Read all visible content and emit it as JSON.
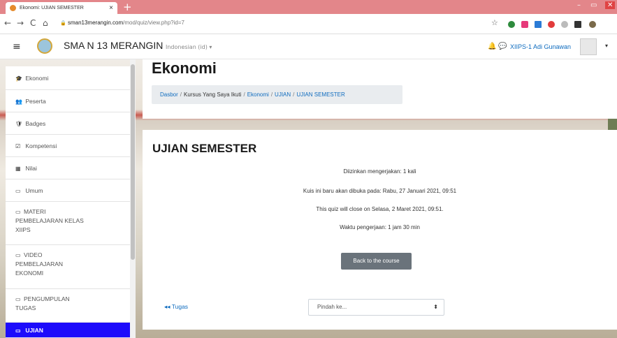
{
  "browser": {
    "tab_title": "Ekonomi: UJIAN SEMESTER",
    "tab_close": "×",
    "new_tab": "+",
    "url_host": "sman13merangin.com",
    "url_path": "/mod/quiz/view.php?id=7",
    "back_icon": "←",
    "forward_icon": "→",
    "reload_icon": "C",
    "home_icon": "⌂",
    "lock_icon": "🔒",
    "star_icon": "☆",
    "minimize": "–",
    "maximize": "▭",
    "close": "✕"
  },
  "navbar": {
    "menu_icon": "≡",
    "site_name": "SMA N 13 MERANGIN",
    "language": "Indonesian (id) ▾",
    "bell_icon": "🔔",
    "chat_icon": "💬",
    "user_name": "XIIPS-1 Adi Gunawan",
    "user_caret": "▾"
  },
  "drawer": {
    "items": [
      {
        "icon": "🎓",
        "label": "Ekonomi"
      },
      {
        "icon": "👥",
        "label": "Peserta"
      },
      {
        "icon": "🛡",
        "label": "Badges"
      },
      {
        "icon": "☑",
        "label": "Kompetensi"
      },
      {
        "icon": "▦",
        "label": "Nilai"
      },
      {
        "icon": "▭",
        "label": "Umum"
      },
      {
        "icon": "▭",
        "label": "MATERI",
        "line2": "PEMBELAJARAN KELAS",
        "line3": "XIIPS"
      },
      {
        "icon": "▭",
        "label": "VIDEO",
        "line2": "PEMBELAJARAN",
        "line3": "EKONOMI"
      },
      {
        "icon": "▭",
        "label": "PENGUMPULAN",
        "line2": "TUGAS"
      },
      {
        "icon": "▭",
        "label": "UJIAN"
      }
    ]
  },
  "header": {
    "course_title": "Ekonomi",
    "breadcrumb": [
      "Dasbor",
      "Kursus Yang Saya Ikuti",
      "Ekonomi",
      "UJIAN",
      "UJIAN SEMESTER"
    ],
    "separator": "/"
  },
  "quiz": {
    "title": "UJIAN SEMESTER",
    "attempts": "Diizinkan mengerjakan: 1 kali",
    "opens": "Kuis ini baru akan dibuka pada: Rabu, 27 Januari 2021, 09:51",
    "closes": "This quiz will close on Selasa, 2 Maret 2021, 09:51.",
    "time_limit": "Waktu pengerjaan: 1 jam 30 min",
    "back_button": "Back to the course",
    "prev_activity": "◂◂ Tugas",
    "jump_placeholder": "Pindah ke...",
    "jump_caret": "⬍"
  },
  "colors": {
    "accent": "#0f6cbf",
    "active_drawer": "#1d0cfb",
    "browser_tabbar": "#e3868a"
  }
}
